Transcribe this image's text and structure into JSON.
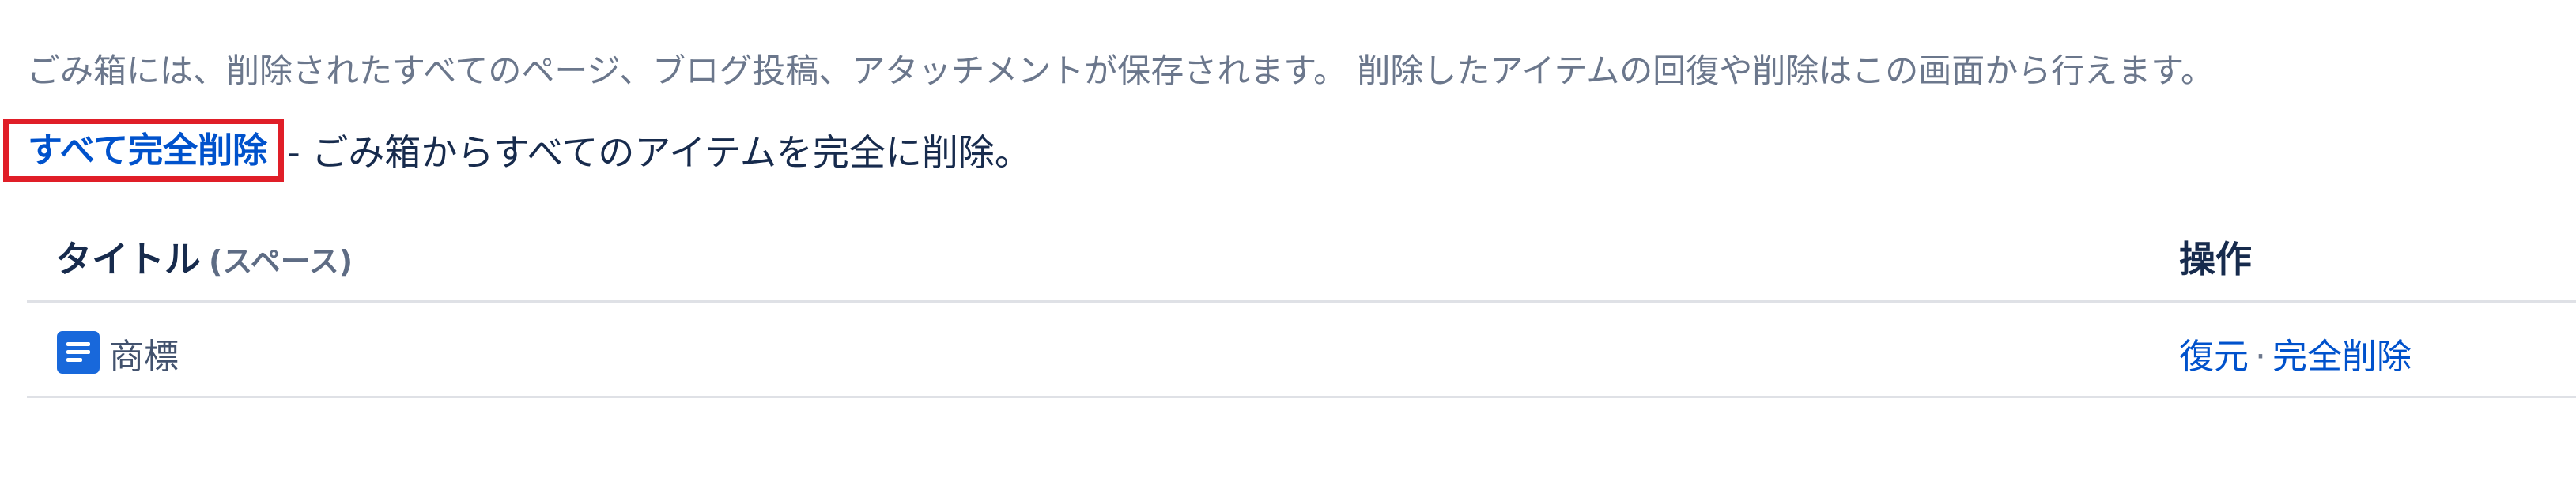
{
  "trash": {
    "intro_text": "ごみ箱には、削除されたすべてのページ、ブログ投稿、アタッチメントが保存されます。 削除したアイテムの回復や削除はこの画面から行えます。",
    "purge_all_link": "すべて完全削除",
    "purge_all_description": "- ごみ箱からすべてのアイテムを完全に削除。"
  },
  "table": {
    "columns": {
      "title": "タイトル",
      "title_sub": "(スペース)",
      "actions": "操作"
    },
    "rows": [
      {
        "icon": "page-icon",
        "title": "商標",
        "restore_label": "復元",
        "separator": "·",
        "purge_label": "完全削除"
      }
    ]
  },
  "colors": {
    "link": "#0052cc",
    "highlight_border": "#e01e28",
    "page_icon": "#1868db",
    "muted_text": "#6b778c"
  }
}
